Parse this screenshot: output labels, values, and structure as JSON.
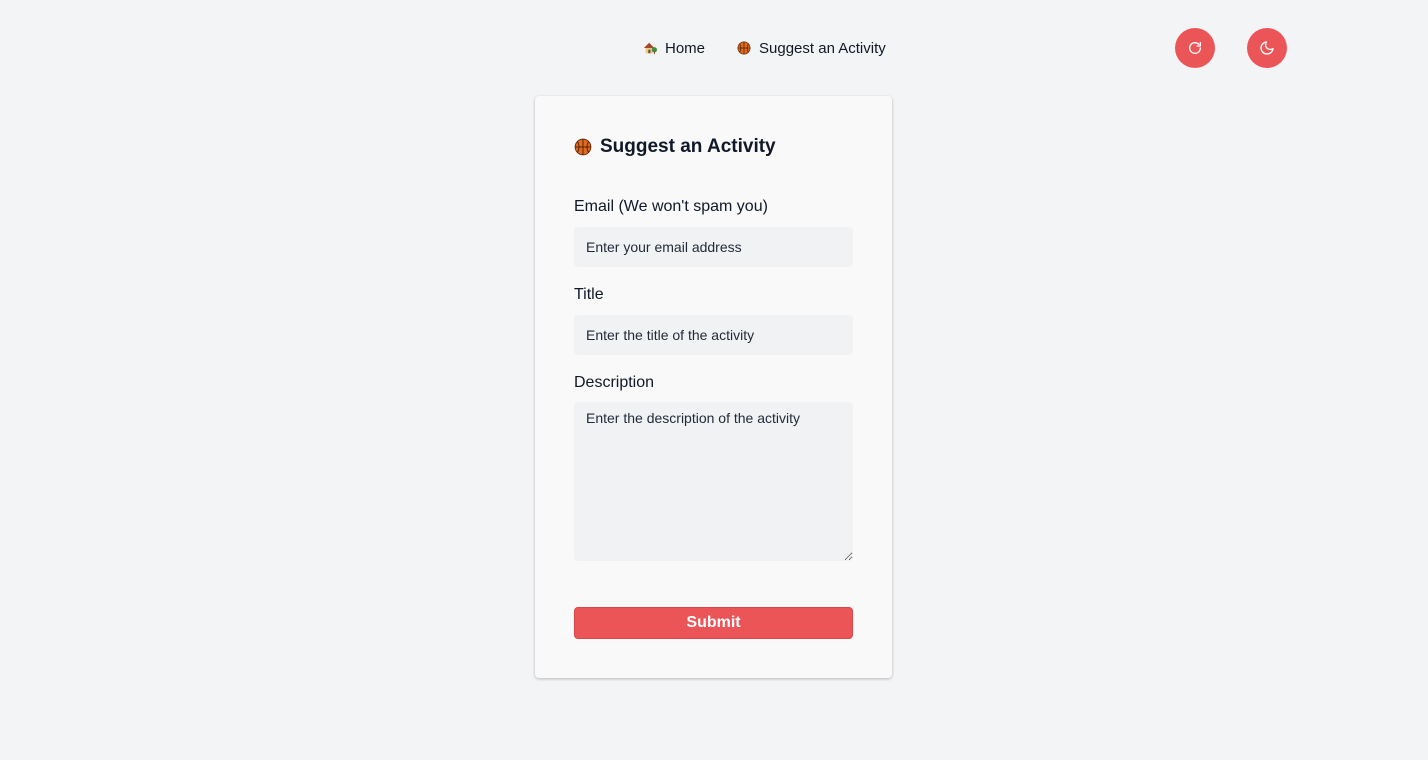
{
  "nav": {
    "links": [
      {
        "label": "Home",
        "icon": "house-with-garden-icon"
      },
      {
        "label": "Suggest an Activity",
        "icon": "basketball-icon"
      }
    ],
    "buttons": {
      "refresh_icon": "refresh-icon",
      "theme_icon": "moon-icon"
    }
  },
  "form": {
    "title": "Suggest an Activity",
    "title_icon": "basketball-icon",
    "email": {
      "label": "Email (We won't spam you)",
      "placeholder": "Enter your email address"
    },
    "title_field": {
      "label": "Title",
      "placeholder": "Enter the title of the activity"
    },
    "description": {
      "label": "Description",
      "placeholder": "Enter the description of the activity"
    },
    "submit_label": "Submit"
  },
  "colors": {
    "accent": "#ec5558",
    "background": "#f3f4f6",
    "card": "#f9f9f9",
    "input": "#f1f2f4"
  }
}
